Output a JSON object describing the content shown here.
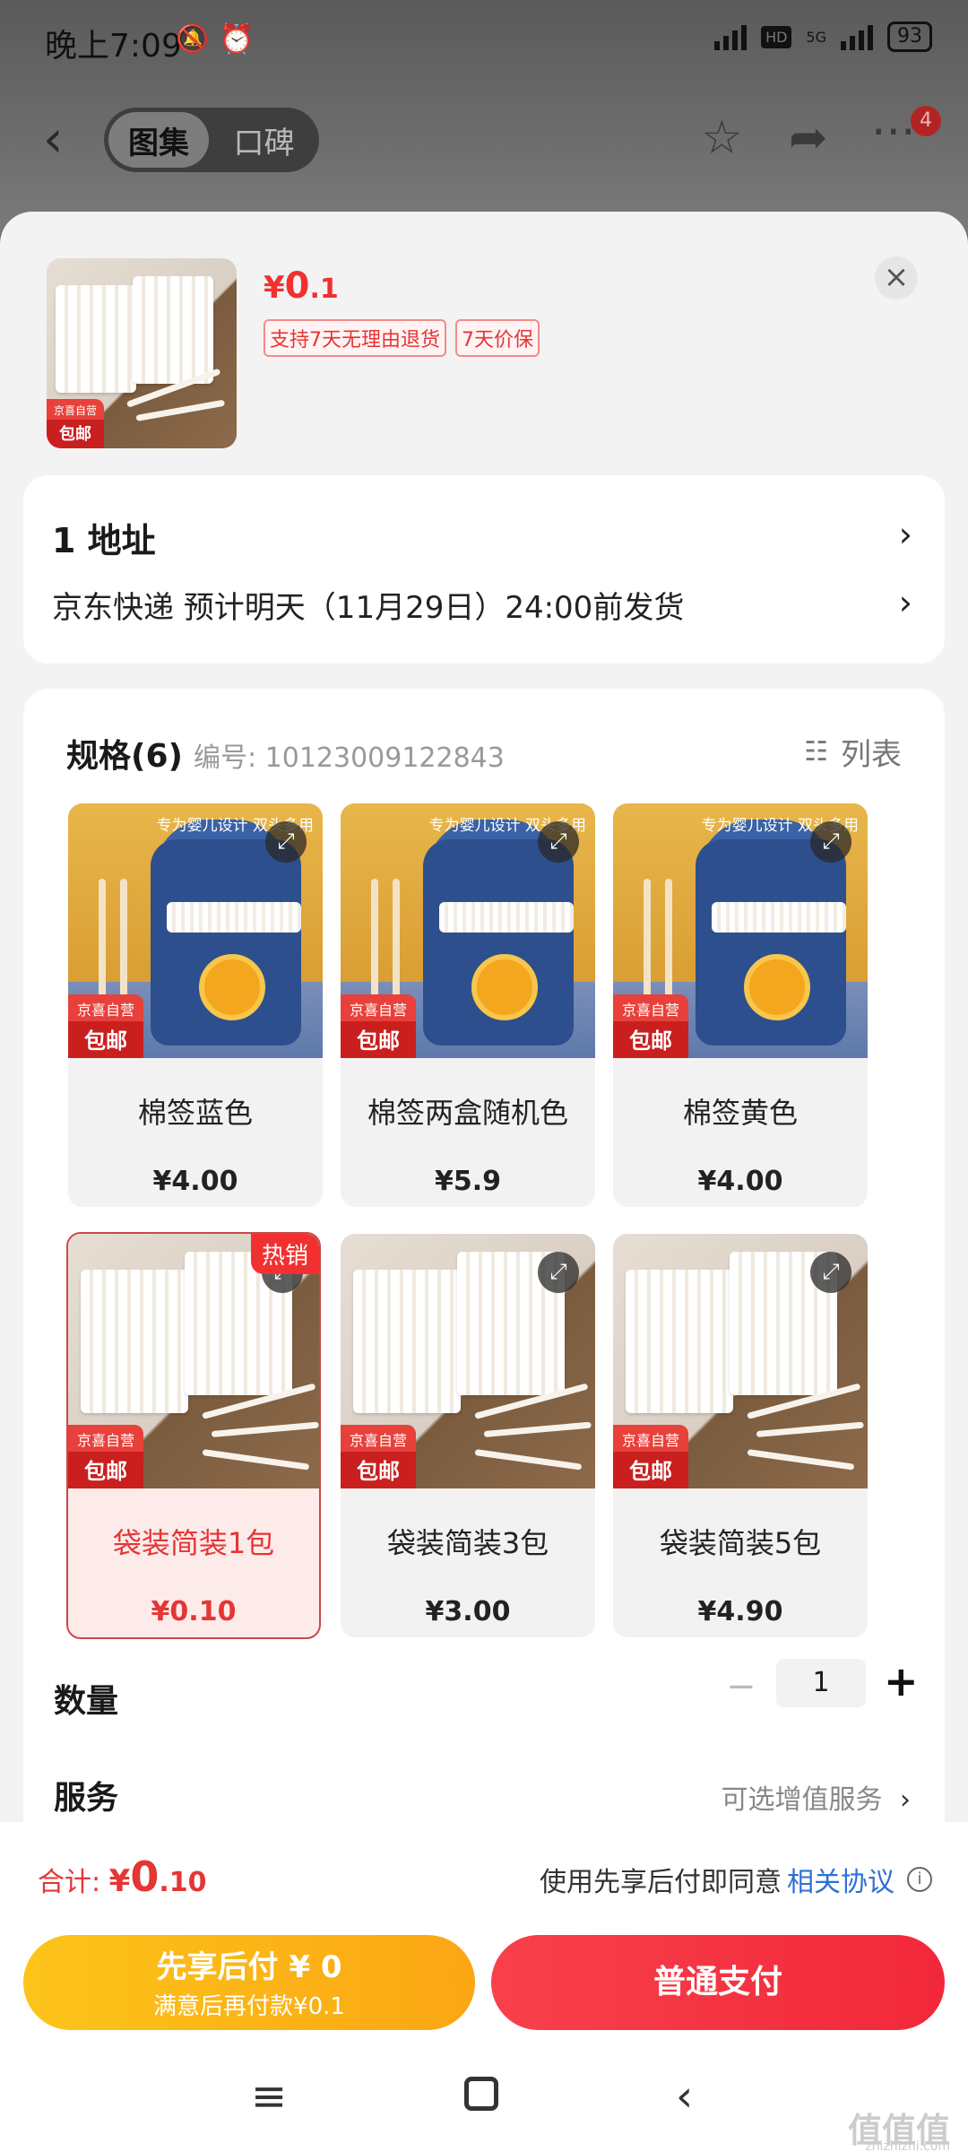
{
  "status_bar": {
    "time": "晚上7:09",
    "hd": "HD",
    "net": "5G",
    "battery": "93"
  },
  "nav": {
    "tabs": [
      "图集",
      "口碑"
    ],
    "badge": "4"
  },
  "product": {
    "price_currency": "¥",
    "price_int": "0",
    "price_dec": ".1",
    "tags": [
      "支持7天无理由退货",
      "7天价保"
    ],
    "thumb_badge_top": "京喜自营",
    "thumb_badge_bottom": "包邮"
  },
  "address": {
    "title": "1  地址",
    "delivery": "京东快递 预计明天（11月29日）24:00前发货"
  },
  "spec": {
    "title": "规格(6)",
    "code": "编号: 10123009122843",
    "list_label": "列表",
    "options": [
      {
        "name": "棉签蓝色",
        "price": "¥4.00",
        "design_text": "专为婴儿设计 双头多用",
        "badge_top": "京喜自营",
        "badge_bottom": "包邮",
        "hot": ""
      },
      {
        "name": "棉签两盒随机色",
        "price": "¥5.9",
        "design_text": "专为婴儿设计 双头多用",
        "badge_top": "京喜自营",
        "badge_bottom": "包邮",
        "hot": ""
      },
      {
        "name": "棉签黄色",
        "price": "¥4.00",
        "design_text": "专为婴儿设计 双头多用",
        "badge_top": "京喜自营",
        "badge_bottom": "包邮",
        "hot": ""
      },
      {
        "name": "袋装简装1包",
        "price": "¥0.10",
        "design_text": "",
        "badge_top": "京喜自营",
        "badge_bottom": "包邮",
        "hot": "热销",
        "selected": true
      },
      {
        "name": "袋装简装3包",
        "price": "¥3.00",
        "design_text": "",
        "badge_top": "京喜自营",
        "badge_bottom": "包邮",
        "hot": ""
      },
      {
        "name": "袋装简装5包",
        "price": "¥4.90",
        "design_text": "",
        "badge_top": "京喜自营",
        "badge_bottom": "包邮",
        "hot": ""
      }
    ]
  },
  "quantity": {
    "label": "数量",
    "value": "1",
    "minus": "−",
    "plus": "+"
  },
  "service": {
    "label": "服务",
    "value": "可选增值服务"
  },
  "footer": {
    "total_label": "合计: ",
    "total_currency": "¥",
    "total_int": "0",
    "total_dec": ".10",
    "agree_text": "使用先享后付即同意",
    "agree_link": "相关协议",
    "later_line1": "先享后付 ¥ 0",
    "later_line2": "满意后再付款¥0.1",
    "pay_label": "普通支付"
  },
  "watermark": {
    "main": "值值值",
    "sub": "zhizhizhi.com"
  },
  "colors": {
    "accent": "#f23030",
    "link": "#2f6fd6",
    "later_btn": "#fba613"
  }
}
